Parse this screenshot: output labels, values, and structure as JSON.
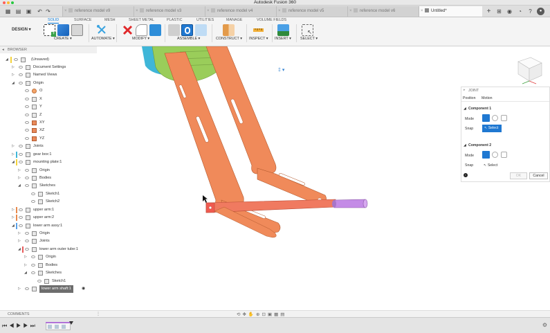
{
  "app_title": "Autodesk Fusion 360",
  "tabs": [
    {
      "label": "reference model v9",
      "active": false
    },
    {
      "label": "reference model v3",
      "active": false
    },
    {
      "label": "reference model v4",
      "active": false
    },
    {
      "label": "reference model v5",
      "active": false
    },
    {
      "label": "reference model v6",
      "active": false
    },
    {
      "label": "Untitled*",
      "active": true
    }
  ],
  "ribbon": {
    "workspace": "DESIGN",
    "tabs": [
      "SOLID",
      "SURFACE",
      "MESH",
      "SHEET METAL",
      "PLASTIC",
      "UTILITIES",
      "MANAGE",
      "VOLUME FIELDS"
    ],
    "active_tab": "SOLID",
    "groups": [
      "CREATE",
      "AUTOMATE",
      "MODIFY",
      "ASSEMBLE",
      "CONSTRUCT",
      "INSPECT",
      "INSERT",
      "SELECT"
    ]
  },
  "browser": {
    "header": "BROWSER",
    "pin": "(Unsaved)",
    "rows": [
      {
        "label": "Document Settings",
        "depth": 1,
        "expand": "closed"
      },
      {
        "label": "Named Views",
        "depth": 1,
        "expand": "closed"
      },
      {
        "label": "Origin",
        "depth": 1,
        "expand": "open"
      },
      {
        "label": "O",
        "depth": 2,
        "expand": "none"
      },
      {
        "label": "X",
        "depth": 2,
        "expand": "none"
      },
      {
        "label": "Y",
        "depth": 2,
        "expand": "none"
      },
      {
        "label": "Z",
        "depth": 2,
        "expand": "none"
      },
      {
        "label": "XY",
        "depth": 2,
        "expand": "none"
      },
      {
        "label": "XZ",
        "depth": 2,
        "expand": "none"
      },
      {
        "label": "YZ",
        "depth": 2,
        "expand": "none"
      },
      {
        "label": "Joints",
        "depth": 1,
        "expand": "closed"
      },
      {
        "label": "gear box:1",
        "depth": 1,
        "expand": "closed",
        "color": "#3fb6d8"
      },
      {
        "label": "mounting plate:1",
        "depth": 1,
        "expand": "open",
        "color": "#f4d23a"
      },
      {
        "label": "Origin",
        "depth": 2,
        "expand": "closed"
      },
      {
        "label": "Bodies",
        "depth": 2,
        "expand": "closed"
      },
      {
        "label": "Sketches",
        "depth": 2,
        "expand": "open"
      },
      {
        "label": "Sketch1",
        "depth": 3,
        "expand": "none"
      },
      {
        "label": "Sketch2",
        "depth": 3,
        "expand": "none"
      },
      {
        "label": "upper arm:1",
        "depth": 1,
        "expand": "closed",
        "color": "#e8894b"
      },
      {
        "label": "upper arm:2",
        "depth": 1,
        "expand": "closed",
        "color": "#e8894b"
      },
      {
        "label": "lower arm assy:1",
        "depth": 1,
        "expand": "open",
        "color": "#5aa0e8"
      },
      {
        "label": "Origin",
        "depth": 2,
        "expand": "closed"
      },
      {
        "label": "Joints",
        "depth": 2,
        "expand": "closed"
      },
      {
        "label": "lower arm outer tube:1",
        "depth": 2,
        "expand": "open",
        "color": "#e85a5a"
      },
      {
        "label": "Origin",
        "depth": 3,
        "expand": "closed"
      },
      {
        "label": "Bodies",
        "depth": 3,
        "expand": "closed"
      },
      {
        "label": "Sketches",
        "depth": 3,
        "expand": "open"
      },
      {
        "label": "Sketch1",
        "depth": 4,
        "expand": "none"
      },
      {
        "label": "lower arm shaft:1",
        "depth": 2,
        "expand": "closed",
        "selected": true
      }
    ]
  },
  "joint_panel": {
    "title": "JOINT",
    "tab_position": "Position",
    "tab_motion": "Motion",
    "component1": "Component 1",
    "component2": "Component 2",
    "mode_label": "Mode",
    "snap_label": "Snap",
    "select_button": "Select",
    "select_label": "Select",
    "ok": "OK",
    "cancel": "Cancel"
  },
  "comments": "COMMENTS",
  "colors": {
    "accent": "#0a7bd8",
    "arm": "#f08a5a",
    "shaft": "#c48be6",
    "gear": "#9acd5a"
  }
}
